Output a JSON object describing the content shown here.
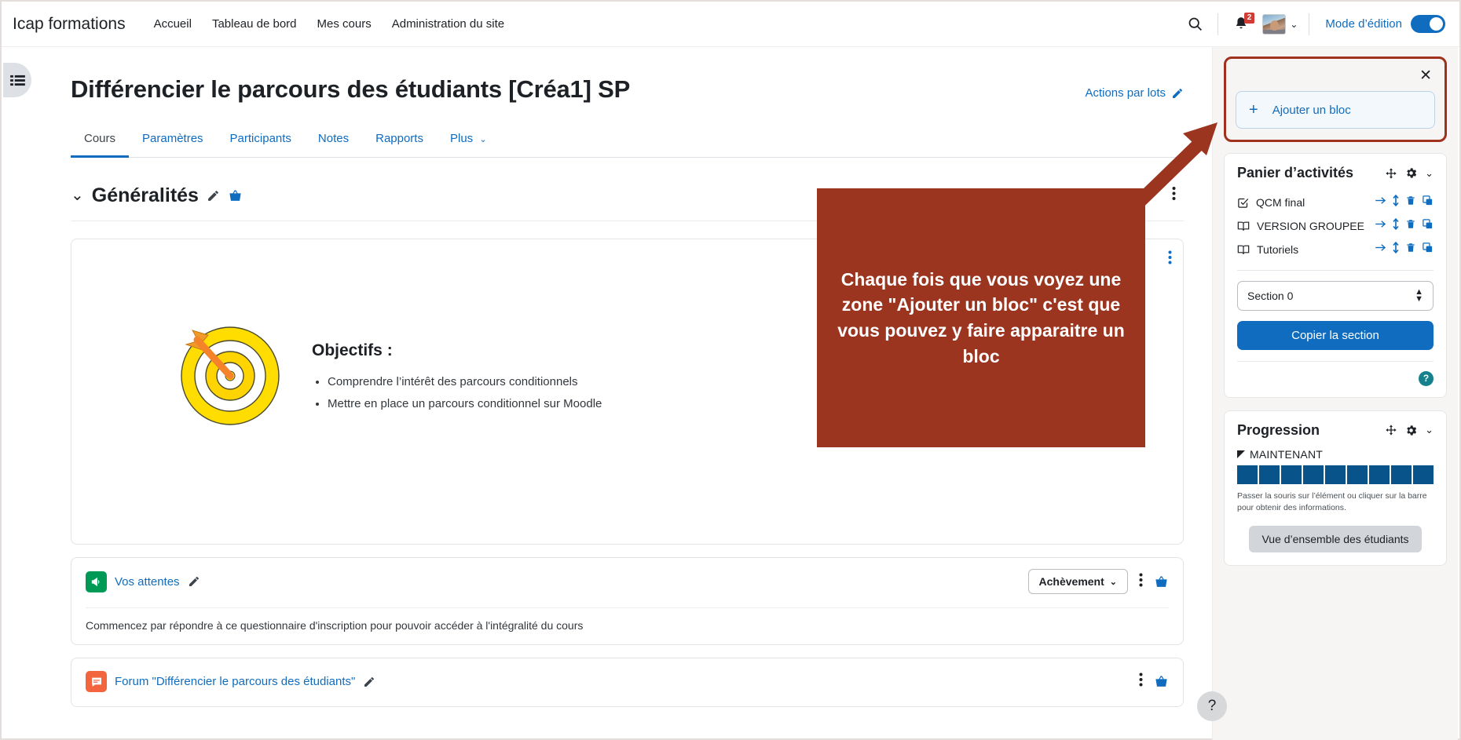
{
  "topnav": {
    "brand": "Icap formations",
    "links": [
      {
        "label": "Accueil"
      },
      {
        "label": "Tableau de bord"
      },
      {
        "label": "Mes cours"
      },
      {
        "label": "Administration du site"
      }
    ],
    "search_icon": "search-icon",
    "notifications_icon": "bell-icon",
    "notifications_badge": "2",
    "avatar_icon": "user-avatar",
    "avatar_chevron": "⌄",
    "edit_mode_label": "Mode d’édition",
    "edit_mode_on": true
  },
  "left_drawer": {
    "toggle_icon": "list-menu-icon"
  },
  "course": {
    "title": "Différencier le parcours des étudiants [Créa1] SP",
    "bulk_actions_label": "Actions par lots",
    "bulk_actions_icon": "pencil-icon",
    "tabs": [
      {
        "label": "Cours",
        "active": true
      },
      {
        "label": "Paramètres",
        "active": false
      },
      {
        "label": "Participants",
        "active": false
      },
      {
        "label": "Notes",
        "active": false
      },
      {
        "label": "Rapports",
        "active": false
      },
      {
        "label": "Plus",
        "active": false,
        "chevron": "⌄"
      }
    ]
  },
  "section": {
    "collapse_chevron": "⌄",
    "title": "Généralités",
    "edit_icon": "pencil-icon",
    "basket_icon": "basket-icon",
    "kebab_icon": "kebab-menu-icon"
  },
  "summary": {
    "target_icon": "target-bullseye-icon",
    "kebab_icon": "kebab-menu-icon",
    "objectifs_title": "Objectifs :",
    "objectifs": [
      "Comprendre l’intérêt des parcours conditionnels",
      "Mettre en place un parcours conditionnel sur Moodle"
    ]
  },
  "activities": [
    {
      "icon": "feedback-megaphone-icon",
      "icon_kind": "feedback",
      "name": "Vos attentes",
      "edit_icon": "pencil-icon",
      "achievement_label": "Achèvement",
      "achievement_chevron": "⌄",
      "kebab_icon": "kebab-menu-icon",
      "basket_icon": "basket-icon",
      "description": "Commencez par répondre à ce questionnaire d'inscription pour pouvoir accéder à l'intégralité du cours"
    },
    {
      "icon": "forum-speech-bubble-icon",
      "icon_kind": "forum",
      "name": "Forum \"Différencier le parcours des étudiants\"",
      "edit_icon": "pencil-icon",
      "achievement_label": "",
      "kebab_icon": "kebab-menu-icon",
      "basket_icon": "basket-icon",
      "description": ""
    }
  ],
  "sidebar": {
    "close_icon": "✕",
    "add_block": {
      "plus": "+",
      "label": "Ajouter un bloc"
    },
    "panier": {
      "title": "Panier d’activités",
      "move_icon": "move-arrows-icon",
      "gear_icon": "gear-icon",
      "chevron_icon": "⌄",
      "items": [
        {
          "icon": "checkbox-quiz-icon",
          "label": "QCM final"
        },
        {
          "icon": "book-icon",
          "label": "VERSION GROUPEE"
        },
        {
          "icon": "book-icon",
          "label": "Tutoriels"
        }
      ],
      "item_actions": [
        {
          "icon": "arrow-right-icon",
          "name": "move-to"
        },
        {
          "icon": "arrows-updown-icon",
          "name": "reorder"
        },
        {
          "icon": "trash-icon",
          "name": "delete"
        },
        {
          "icon": "copy-icon",
          "name": "duplicate"
        }
      ],
      "section_select_value": "Section 0",
      "copy_button_label": "Copier la section",
      "help_icon": "?"
    },
    "progression": {
      "title": "Progression",
      "move_icon": "move-arrows-icon",
      "gear_icon": "gear-icon",
      "chevron_icon": "⌄",
      "now_label": "MAINTENANT",
      "segment_count": 9,
      "segment_color": "#08538a",
      "note": "Passer la souris sur l’élément ou cliquer sur la barre pour obtenir des informations.",
      "overview_button_label": "Vue d’ensemble des étudiants"
    }
  },
  "annotation": {
    "callout_text": "Chaque fois que vous voyez une zone \"Ajouter un bloc\" c'est que vous pouvez y faire apparaitre un bloc",
    "callout_color": "#9b3520",
    "highlight_color": "#a0311c",
    "arrow_icon": "arrow-up-right-icon"
  },
  "floating_help": {
    "label": "?"
  }
}
